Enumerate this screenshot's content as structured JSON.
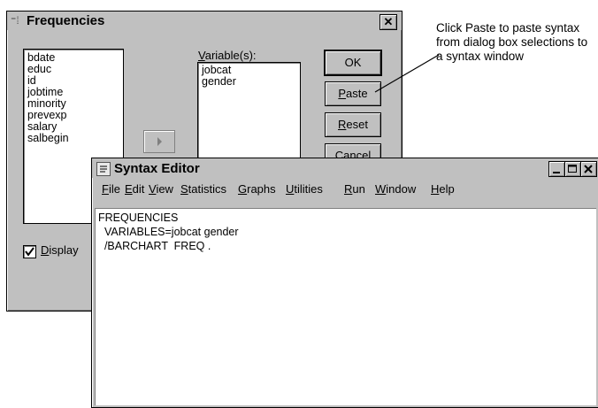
{
  "frequencies_dialog": {
    "title": "Frequencies",
    "close_glyph": "✕",
    "source_list": [
      "bdate",
      "educ",
      "id",
      "jobtime",
      "minority",
      "prevexp",
      "salary",
      "salbegin"
    ],
    "variables_label": "Variable(s):",
    "variables_list": [
      "jobcat",
      "gender"
    ],
    "buttons": {
      "ok": "OK",
      "paste": "Paste",
      "reset": "Reset",
      "cancel": "Cancel"
    },
    "display_checkbox": {
      "label": "Display",
      "checked": true
    }
  },
  "syntax_editor": {
    "title": "Syntax Editor",
    "menus": [
      "File",
      "Edit",
      "View",
      "Statistics",
      "Graphs",
      "Utilities",
      "Run",
      "Window",
      "Help"
    ],
    "code_lines": [
      "FREQUENCIES",
      "  VARIABLES=jobcat gender",
      "  /BARCHART  FREQ ."
    ]
  },
  "annotation": {
    "text": "Click Paste to paste syntax from dialog box selections to a syntax window"
  }
}
